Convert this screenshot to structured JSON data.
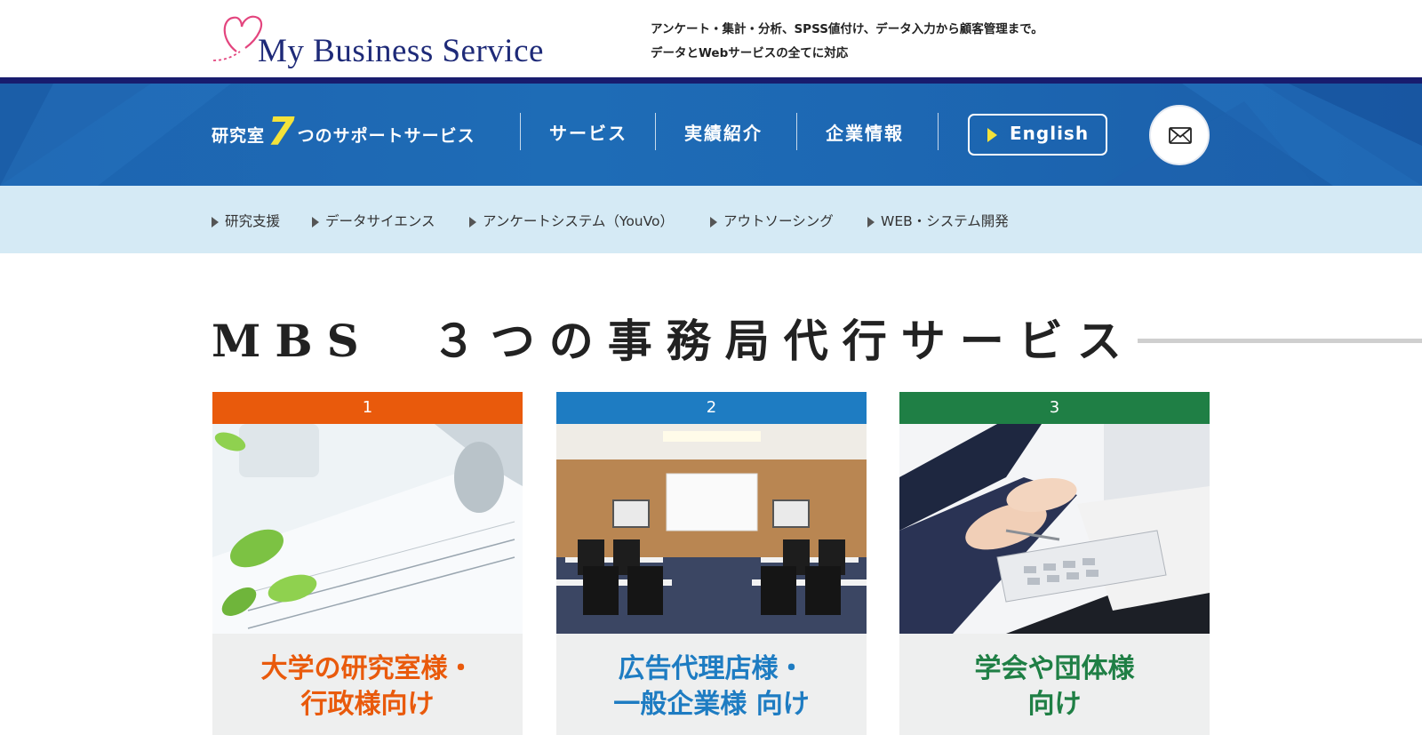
{
  "header": {
    "logo_text": "My Business Service",
    "tagline_line1": "アンケート・集計・分析、SPSS値付け、データ入力から顧客管理まで。",
    "tagline_line2": "データとWebサービスの全てに対応"
  },
  "nav": {
    "brand_prefix": "研究室",
    "brand_number": "7",
    "brand_suffix": "つのサポートサービス",
    "links": [
      "サービス",
      "実績紹介",
      "企業情報"
    ],
    "english_label": "English",
    "mail_icon": "mail-icon"
  },
  "subnav": {
    "items": [
      "研究支援",
      "データサイエンス",
      "アンケートシステム（YouVo）",
      "アウトソーシング",
      "WEB・システム開発"
    ]
  },
  "section": {
    "title": "MBS　３つの事務局代行サービス"
  },
  "cards": [
    {
      "number": "1",
      "title_line1": "大学の研究室様・",
      "title_line2": "行政様向け",
      "color": "#e95a0c"
    },
    {
      "number": "2",
      "title_line1": "広告代理店様・",
      "title_line2": "一般企業様 向け",
      "color": "#1e7cc2"
    },
    {
      "number": "3",
      "title_line1": "学会や団体様",
      "title_line2": "向け",
      "color": "#1f7f45"
    }
  ],
  "colors": {
    "navy": "#181c6e",
    "nav_blue": "#1e6cb6",
    "subnav_bg": "#d5eaf5",
    "accent_yellow": "#f4e23a"
  }
}
